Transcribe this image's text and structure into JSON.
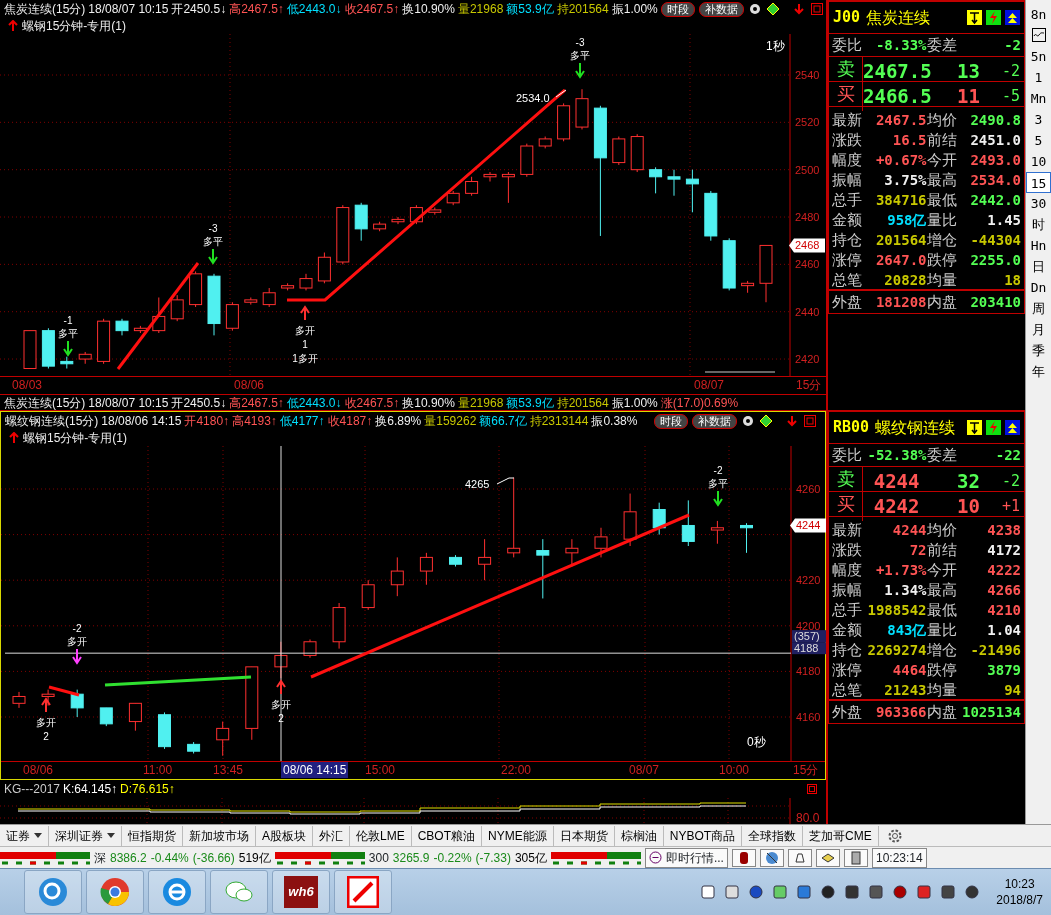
{
  "upper_chart": {
    "header": [
      {
        "text": "焦炭连续(15分)",
        "kind": "flat"
      },
      {
        "text": "18/08/07 10:15",
        "kind": "flat"
      },
      {
        "text": "开2450.5↓",
        "kind": "flat"
      },
      {
        "text": "高2467.5↑",
        "kind": "rise"
      },
      {
        "text": "低2443.0↓",
        "kind": "low"
      },
      {
        "text": "收2467.5↑",
        "kind": "rise"
      },
      {
        "text": "换10.90%",
        "kind": "flat"
      },
      {
        "text": "量21968",
        "kind": "volume"
      },
      {
        "text": "额53.9亿",
        "kind": "amount"
      },
      {
        "text": "持201564",
        "kind": "volume"
      },
      {
        "text": "振1.00%",
        "kind": "flat"
      }
    ],
    "buttons": [
      "时段",
      "补数据"
    ],
    "study": "螺钢15分钟-专用(1)",
    "timer": "1秒",
    "y_ticks": [
      "2540",
      "2520",
      "2500",
      "2480",
      "2460",
      "2440",
      "2420"
    ],
    "price_tag": "2468",
    "peak_label": "2534.0",
    "signals": [
      {
        "kind": "close",
        "lines": [
          "-1",
          "多平"
        ]
      },
      {
        "kind": "close",
        "lines": [
          "-3",
          "多平"
        ]
      },
      {
        "kind": "open",
        "lines": [
          "多开",
          "1",
          "1多开"
        ]
      },
      {
        "kind": "close",
        "lines": [
          "-3",
          "多平"
        ]
      }
    ],
    "x_labels": [
      "08/03",
      "08/06",
      "08/07"
    ],
    "period": "15分"
  },
  "summary_line": [
    {
      "text": "焦炭连续(15分)",
      "kind": "flat"
    },
    {
      "text": "18/08/07 10:15",
      "kind": "flat"
    },
    {
      "text": "开2450.5↓",
      "kind": "flat"
    },
    {
      "text": "高2467.5↑",
      "kind": "rise"
    },
    {
      "text": "低2443.0↓",
      "kind": "low"
    },
    {
      "text": "收2467.5↑",
      "kind": "rise"
    },
    {
      "text": "换10.90%",
      "kind": "flat"
    },
    {
      "text": "量21968",
      "kind": "volume"
    },
    {
      "text": "额53.9亿",
      "kind": "amount"
    },
    {
      "text": "持201564",
      "kind": "volume"
    },
    {
      "text": "振1.00%",
      "kind": "flat"
    },
    {
      "text": "涨(17.0)0.69%",
      "kind": "rise"
    }
  ],
  "lower_chart": {
    "header": [
      {
        "text": "螺纹钢连续(15分)",
        "kind": "flat"
      },
      {
        "text": "18/08/06 14:15",
        "kind": "flat"
      },
      {
        "text": "开4180↑",
        "kind": "rise"
      },
      {
        "text": "高4193↑",
        "kind": "rise"
      },
      {
        "text": "低4177↑",
        "kind": "low"
      },
      {
        "text": "收4187↑",
        "kind": "rise"
      },
      {
        "text": "换6.89%",
        "kind": "flat"
      },
      {
        "text": "量159262",
        "kind": "volume"
      },
      {
        "text": "额66.7亿",
        "kind": "amount"
      },
      {
        "text": "持2313144",
        "kind": "volume"
      },
      {
        "text": "振0.38%",
        "kind": "flat"
      }
    ],
    "buttons": [
      "时段",
      "补数据"
    ],
    "study": "螺钢15分钟-专用(1)",
    "timer": "0秒",
    "y_ticks": [
      "4260",
      "4220",
      "4200",
      "4180",
      "4160"
    ],
    "price_tag": "4244",
    "cross_count": "(357)",
    "cross_price": "4188",
    "peak_label": "4265",
    "signals": [
      {
        "kind": "switch",
        "lines": [
          "-2",
          "多开"
        ]
      },
      {
        "kind": "open",
        "lines": [
          "多开",
          "2"
        ]
      },
      {
        "kind": "open",
        "lines": [
          "多开",
          "2"
        ]
      },
      {
        "kind": "close",
        "lines": [
          "-2",
          "多平"
        ]
      }
    ],
    "x_labels": [
      "08/06",
      "11:00",
      "13:45",
      "15:00",
      "22:00",
      "08/07",
      "10:00"
    ],
    "cross_time": "08/06 14:15",
    "period": "15分"
  },
  "indicator": {
    "name": "KG---2017",
    "k": "K:64.145↑",
    "d": "D:76.615↑",
    "tick": "80.0"
  },
  "quotes": [
    {
      "code": "J00",
      "name": "焦炭连续",
      "ratio": {
        "label": "委比",
        "value": "-8.33%",
        "kind": "fall"
      },
      "diff": {
        "label": "委差",
        "value": "-2",
        "kind": "fall"
      },
      "book": [
        {
          "side": {
            "text": "卖",
            "kind": "fall"
          },
          "price": {
            "text": "2467.5",
            "kind": "fall"
          },
          "qty": {
            "text": "13",
            "kind": "fall"
          },
          "change": {
            "text": "-2",
            "kind": "fall"
          }
        },
        {
          "side": {
            "text": "买",
            "kind": "rise"
          },
          "price": {
            "text": "2466.5",
            "kind": "fall"
          },
          "qty": {
            "text": "11",
            "kind": "rise"
          },
          "change": {
            "text": "-5",
            "kind": "fall"
          }
        }
      ],
      "stats": [
        {
          "label": "最新",
          "value": "2467.5",
          "kind": "rise"
        },
        {
          "label": "均价",
          "value": "2490.8",
          "kind": "fall"
        },
        {
          "label": "涨跌",
          "value": "16.5",
          "kind": "rise"
        },
        {
          "label": "前结",
          "value": "2451.0",
          "kind": "flat"
        },
        {
          "label": "幅度",
          "value": "+0.67%",
          "kind": "rise"
        },
        {
          "label": "今开",
          "value": "2493.0",
          "kind": "rise"
        },
        {
          "label": "振幅",
          "value": "3.75%",
          "kind": "flat"
        },
        {
          "label": "最高",
          "value": "2534.0",
          "kind": "rise"
        },
        {
          "label": "总手",
          "value": "384716",
          "kind": "volume"
        },
        {
          "label": "最低",
          "value": "2442.0",
          "kind": "fall"
        },
        {
          "label": "金额",
          "value": "958亿",
          "kind": "amount"
        },
        {
          "label": "量比",
          "value": "1.45",
          "kind": "flat"
        },
        {
          "label": "持仓",
          "value": "201564",
          "kind": "volume"
        },
        {
          "label": "增仓",
          "value": "-44304",
          "kind": "volume"
        },
        {
          "label": "涨停",
          "value": "2647.0",
          "kind": "rise"
        },
        {
          "label": "跌停",
          "value": "2255.0",
          "kind": "fall"
        },
        {
          "label": "总笔",
          "value": "20828",
          "kind": "volume"
        },
        {
          "label": "均量",
          "value": "18",
          "kind": "volume"
        }
      ],
      "outer": {
        "label": "外盘",
        "value": "181208",
        "kind": "rise"
      },
      "inner": {
        "label": "内盘",
        "value": "203410",
        "kind": "fall"
      }
    },
    {
      "code": "RB00",
      "name": "螺纹钢连续",
      "ratio": {
        "label": "委比",
        "value": "-52.38%",
        "kind": "fall"
      },
      "diff": {
        "label": "委差",
        "value": "-22",
        "kind": "fall"
      },
      "book": [
        {
          "side": {
            "text": "卖",
            "kind": "fall"
          },
          "price": {
            "text": "4244",
            "kind": "rise"
          },
          "qty": {
            "text": "32",
            "kind": "fall"
          },
          "change": {
            "text": "-2",
            "kind": "fall"
          }
        },
        {
          "side": {
            "text": "买",
            "kind": "rise"
          },
          "price": {
            "text": "4242",
            "kind": "rise"
          },
          "qty": {
            "text": "10",
            "kind": "rise"
          },
          "change": {
            "text": "+1",
            "kind": "rise"
          }
        }
      ],
      "stats": [
        {
          "label": "最新",
          "value": "4244",
          "kind": "rise"
        },
        {
          "label": "均价",
          "value": "4238",
          "kind": "rise"
        },
        {
          "label": "涨跌",
          "value": "72",
          "kind": "rise"
        },
        {
          "label": "前结",
          "value": "4172",
          "kind": "flat"
        },
        {
          "label": "幅度",
          "value": "+1.73%",
          "kind": "rise"
        },
        {
          "label": "今开",
          "value": "4222",
          "kind": "rise"
        },
        {
          "label": "振幅",
          "value": "1.34%",
          "kind": "flat"
        },
        {
          "label": "最高",
          "value": "4266",
          "kind": "rise"
        },
        {
          "label": "总手",
          "value": "1988542",
          "kind": "volume"
        },
        {
          "label": "最低",
          "value": "4210",
          "kind": "rise"
        },
        {
          "label": "金额",
          "value": "843亿",
          "kind": "amount"
        },
        {
          "label": "量比",
          "value": "1.04",
          "kind": "flat"
        },
        {
          "label": "持仓",
          "value": "2269274",
          "kind": "volume"
        },
        {
          "label": "增仓",
          "value": "-21496",
          "kind": "volume"
        },
        {
          "label": "涨停",
          "value": "4464",
          "kind": "rise"
        },
        {
          "label": "跌停",
          "value": "3879",
          "kind": "fall"
        },
        {
          "label": "总笔",
          "value": "21243",
          "kind": "volume"
        },
        {
          "label": "均量",
          "value": "94",
          "kind": "volume"
        }
      ],
      "outer": {
        "label": "外盘",
        "value": "963366",
        "kind": "rise"
      },
      "inner": {
        "label": "内盘",
        "value": "1025134",
        "kind": "fall"
      }
    }
  ],
  "period_toolbar": [
    {
      "label": "8n",
      "selected": false
    },
    {
      "kind": "icon",
      "selected": false
    },
    {
      "label": "5n",
      "selected": false
    },
    {
      "label": "1",
      "selected": false
    },
    {
      "label": "Mn",
      "selected": false
    },
    {
      "label": "3",
      "selected": false
    },
    {
      "label": "5",
      "selected": false
    },
    {
      "label": "10",
      "selected": false
    },
    {
      "label": "15",
      "selected": true
    },
    {
      "label": "30",
      "selected": false
    },
    {
      "label": "时",
      "selected": false
    },
    {
      "label": "Hn",
      "selected": false
    },
    {
      "label": "日",
      "selected": false
    },
    {
      "label": "Dn",
      "selected": false
    },
    {
      "label": "周",
      "selected": false
    },
    {
      "label": "月",
      "selected": false
    },
    {
      "label": "季",
      "selected": false
    },
    {
      "label": "年",
      "selected": false
    }
  ],
  "market_tabs": [
    {
      "label": "证券",
      "dropdown": true
    },
    {
      "label": "深圳证券",
      "dropdown": true
    },
    {
      "label": "恒指期货",
      "dropdown": false
    },
    {
      "label": "新加坡市场",
      "dropdown": false
    },
    {
      "label": "A股板块",
      "dropdown": false
    },
    {
      "label": "外汇",
      "dropdown": false
    },
    {
      "label": "伦敦LME",
      "dropdown": false
    },
    {
      "label": "CBOT粮油",
      "dropdown": false
    },
    {
      "label": "NYME能源",
      "dropdown": false
    },
    {
      "label": "日本期货",
      "dropdown": false
    },
    {
      "label": "棕榈油",
      "dropdown": false
    },
    {
      "label": "NYBOT商品",
      "dropdown": false
    },
    {
      "label": "全球指数",
      "dropdown": false
    },
    {
      "label": "芝加哥CME",
      "dropdown": false
    }
  ],
  "ticker": [
    {
      "name": "深",
      "values": [
        {
          "text": "8386.2",
          "kind": "fall"
        },
        {
          "text": "-0.44%",
          "kind": "fall"
        },
        {
          "text": "(-36.66)",
          "kind": "fall"
        },
        {
          "text": "519亿",
          "kind": "flat"
        }
      ]
    },
    {
      "name": "300",
      "values": [
        {
          "text": "3265.9",
          "kind": "fall"
        },
        {
          "text": "-0.22%",
          "kind": "fall"
        },
        {
          "text": "(-7.33)",
          "kind": "fall"
        },
        {
          "text": "305亿",
          "kind": "flat"
        }
      ]
    }
  ],
  "quote_button": "即时行情...",
  "ticker_time": "10:23:14",
  "taskbar": {
    "logo_label": "wh6",
    "time": "10:23",
    "date": "2018/8/7"
  }
}
